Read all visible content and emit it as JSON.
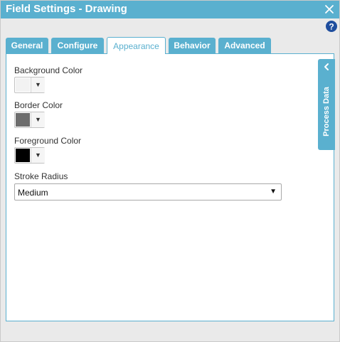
{
  "dialog": {
    "title": "Field Settings - Drawing",
    "close_icon": "close-icon",
    "help_icon": "help-icon"
  },
  "tabs": [
    {
      "label": "General",
      "active": false
    },
    {
      "label": "Configure",
      "active": false
    },
    {
      "label": "Appearance",
      "active": true
    },
    {
      "label": "Behavior",
      "active": false
    },
    {
      "label": "Advanced",
      "active": false
    }
  ],
  "appearance": {
    "background_color": {
      "label": "Background Color",
      "value": "#f2f2f2"
    },
    "border_color": {
      "label": "Border Color",
      "value": "#6d6d6d"
    },
    "foreground_color": {
      "label": "Foreground Color",
      "value": "#000000"
    },
    "stroke_radius": {
      "label": "Stroke Radius",
      "value": "Medium"
    }
  },
  "process_data": {
    "label": "Process Data",
    "toggle_icon": "chevron-left-icon"
  },
  "colors": {
    "accent": "#5ab0cf",
    "panel_background": "#eaeaea"
  }
}
